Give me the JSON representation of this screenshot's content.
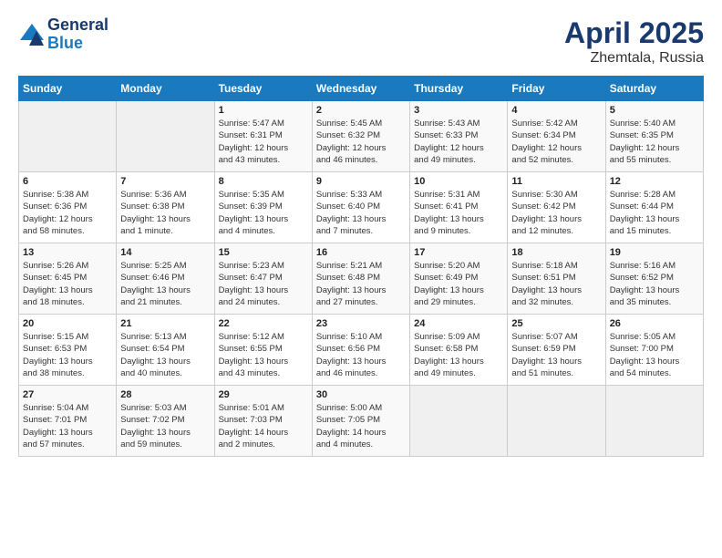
{
  "header": {
    "logo_line1": "General",
    "logo_line2": "Blue",
    "month": "April 2025",
    "location": "Zhemtala, Russia"
  },
  "weekdays": [
    "Sunday",
    "Monday",
    "Tuesday",
    "Wednesday",
    "Thursday",
    "Friday",
    "Saturday"
  ],
  "weeks": [
    [
      {
        "day": "",
        "info": ""
      },
      {
        "day": "",
        "info": ""
      },
      {
        "day": "1",
        "info": "Sunrise: 5:47 AM\nSunset: 6:31 PM\nDaylight: 12 hours\nand 43 minutes."
      },
      {
        "day": "2",
        "info": "Sunrise: 5:45 AM\nSunset: 6:32 PM\nDaylight: 12 hours\nand 46 minutes."
      },
      {
        "day": "3",
        "info": "Sunrise: 5:43 AM\nSunset: 6:33 PM\nDaylight: 12 hours\nand 49 minutes."
      },
      {
        "day": "4",
        "info": "Sunrise: 5:42 AM\nSunset: 6:34 PM\nDaylight: 12 hours\nand 52 minutes."
      },
      {
        "day": "5",
        "info": "Sunrise: 5:40 AM\nSunset: 6:35 PM\nDaylight: 12 hours\nand 55 minutes."
      }
    ],
    [
      {
        "day": "6",
        "info": "Sunrise: 5:38 AM\nSunset: 6:36 PM\nDaylight: 12 hours\nand 58 minutes."
      },
      {
        "day": "7",
        "info": "Sunrise: 5:36 AM\nSunset: 6:38 PM\nDaylight: 13 hours\nand 1 minute."
      },
      {
        "day": "8",
        "info": "Sunrise: 5:35 AM\nSunset: 6:39 PM\nDaylight: 13 hours\nand 4 minutes."
      },
      {
        "day": "9",
        "info": "Sunrise: 5:33 AM\nSunset: 6:40 PM\nDaylight: 13 hours\nand 7 minutes."
      },
      {
        "day": "10",
        "info": "Sunrise: 5:31 AM\nSunset: 6:41 PM\nDaylight: 13 hours\nand 9 minutes."
      },
      {
        "day": "11",
        "info": "Sunrise: 5:30 AM\nSunset: 6:42 PM\nDaylight: 13 hours\nand 12 minutes."
      },
      {
        "day": "12",
        "info": "Sunrise: 5:28 AM\nSunset: 6:44 PM\nDaylight: 13 hours\nand 15 minutes."
      }
    ],
    [
      {
        "day": "13",
        "info": "Sunrise: 5:26 AM\nSunset: 6:45 PM\nDaylight: 13 hours\nand 18 minutes."
      },
      {
        "day": "14",
        "info": "Sunrise: 5:25 AM\nSunset: 6:46 PM\nDaylight: 13 hours\nand 21 minutes."
      },
      {
        "day": "15",
        "info": "Sunrise: 5:23 AM\nSunset: 6:47 PM\nDaylight: 13 hours\nand 24 minutes."
      },
      {
        "day": "16",
        "info": "Sunrise: 5:21 AM\nSunset: 6:48 PM\nDaylight: 13 hours\nand 27 minutes."
      },
      {
        "day": "17",
        "info": "Sunrise: 5:20 AM\nSunset: 6:49 PM\nDaylight: 13 hours\nand 29 minutes."
      },
      {
        "day": "18",
        "info": "Sunrise: 5:18 AM\nSunset: 6:51 PM\nDaylight: 13 hours\nand 32 minutes."
      },
      {
        "day": "19",
        "info": "Sunrise: 5:16 AM\nSunset: 6:52 PM\nDaylight: 13 hours\nand 35 minutes."
      }
    ],
    [
      {
        "day": "20",
        "info": "Sunrise: 5:15 AM\nSunset: 6:53 PM\nDaylight: 13 hours\nand 38 minutes."
      },
      {
        "day": "21",
        "info": "Sunrise: 5:13 AM\nSunset: 6:54 PM\nDaylight: 13 hours\nand 40 minutes."
      },
      {
        "day": "22",
        "info": "Sunrise: 5:12 AM\nSunset: 6:55 PM\nDaylight: 13 hours\nand 43 minutes."
      },
      {
        "day": "23",
        "info": "Sunrise: 5:10 AM\nSunset: 6:56 PM\nDaylight: 13 hours\nand 46 minutes."
      },
      {
        "day": "24",
        "info": "Sunrise: 5:09 AM\nSunset: 6:58 PM\nDaylight: 13 hours\nand 49 minutes."
      },
      {
        "day": "25",
        "info": "Sunrise: 5:07 AM\nSunset: 6:59 PM\nDaylight: 13 hours\nand 51 minutes."
      },
      {
        "day": "26",
        "info": "Sunrise: 5:05 AM\nSunset: 7:00 PM\nDaylight: 13 hours\nand 54 minutes."
      }
    ],
    [
      {
        "day": "27",
        "info": "Sunrise: 5:04 AM\nSunset: 7:01 PM\nDaylight: 13 hours\nand 57 minutes."
      },
      {
        "day": "28",
        "info": "Sunrise: 5:03 AM\nSunset: 7:02 PM\nDaylight: 13 hours\nand 59 minutes."
      },
      {
        "day": "29",
        "info": "Sunrise: 5:01 AM\nSunset: 7:03 PM\nDaylight: 14 hours\nand 2 minutes."
      },
      {
        "day": "30",
        "info": "Sunrise: 5:00 AM\nSunset: 7:05 PM\nDaylight: 14 hours\nand 4 minutes."
      },
      {
        "day": "",
        "info": ""
      },
      {
        "day": "",
        "info": ""
      },
      {
        "day": "",
        "info": ""
      }
    ]
  ]
}
